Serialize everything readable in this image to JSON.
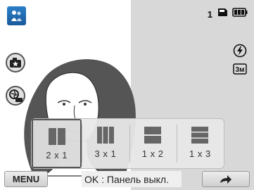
{
  "status": {
    "shot_count": "1"
  },
  "layout_options": [
    {
      "label": "2 x 1",
      "selected": true
    },
    {
      "label": "3 x 1",
      "selected": false
    },
    {
      "label": "1 x 2",
      "selected": false
    },
    {
      "label": "1 x 3",
      "selected": false
    }
  ],
  "bottom_bar": {
    "menu_label": "MENU",
    "hint_text": "OK : Панель выкл."
  },
  "icons": {
    "mode": "portrait-mode-icon",
    "card": "memory-card-icon",
    "battery": "battery-icon",
    "camera_star": "camera-star-icon",
    "shutter_off": "shutter-off-icon",
    "flash_auto": "flash-auto-icon",
    "image_size": "image-size-3m-icon",
    "back": "back-arrow-icon"
  },
  "colors": {
    "accent": "#1a5a9a",
    "panel_bg": "#e8e8e8",
    "right_bg": "#d8d8d8"
  },
  "size_icon_text": "3м",
  "flash_icon_text": "A"
}
